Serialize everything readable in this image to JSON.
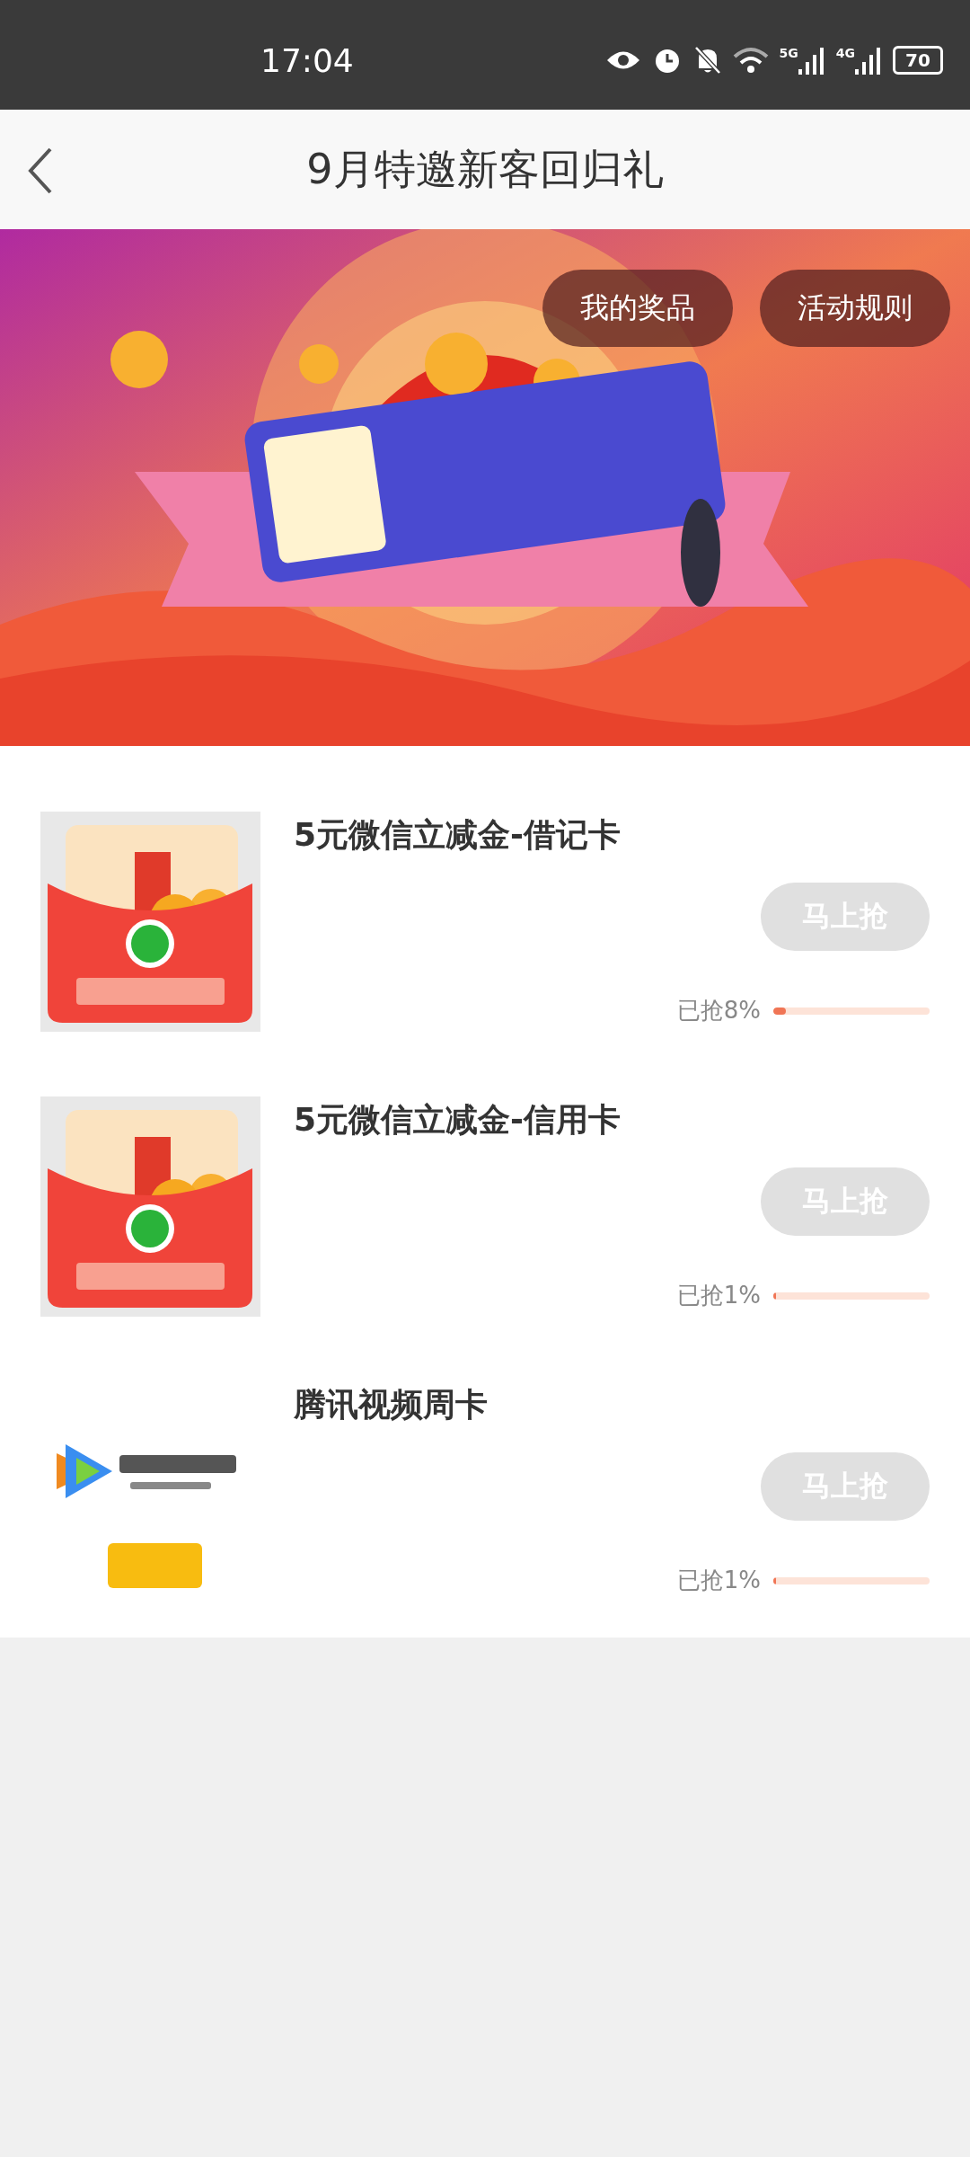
{
  "status_bar": {
    "time": "17:04",
    "sim1_label": "5G",
    "sim2_label": "4G",
    "battery": "70"
  },
  "header": {
    "title": "9月特邀新客回归礼"
  },
  "banner": {
    "kind": "picture",
    "buttons": [
      "我的奖品",
      "活动规则"
    ]
  },
  "items": [
    {
      "title": "5元微信立减金-借记卡",
      "kind": "wechat",
      "button": "马上抢",
      "disabled": true,
      "progress_text": "已抢8%",
      "level": 0.08
    },
    {
      "title": "5元微信立减金-信用卡",
      "kind": "wechat",
      "button": "马上抢",
      "disabled": true,
      "progress_text": "已抢1%",
      "level": 0.01
    },
    {
      "title": "腾讯视频周卡",
      "kind": "video",
      "button": "马上抢",
      "disabled": true,
      "progress_text": "已抢1%",
      "level": 0.01
    }
  ]
}
